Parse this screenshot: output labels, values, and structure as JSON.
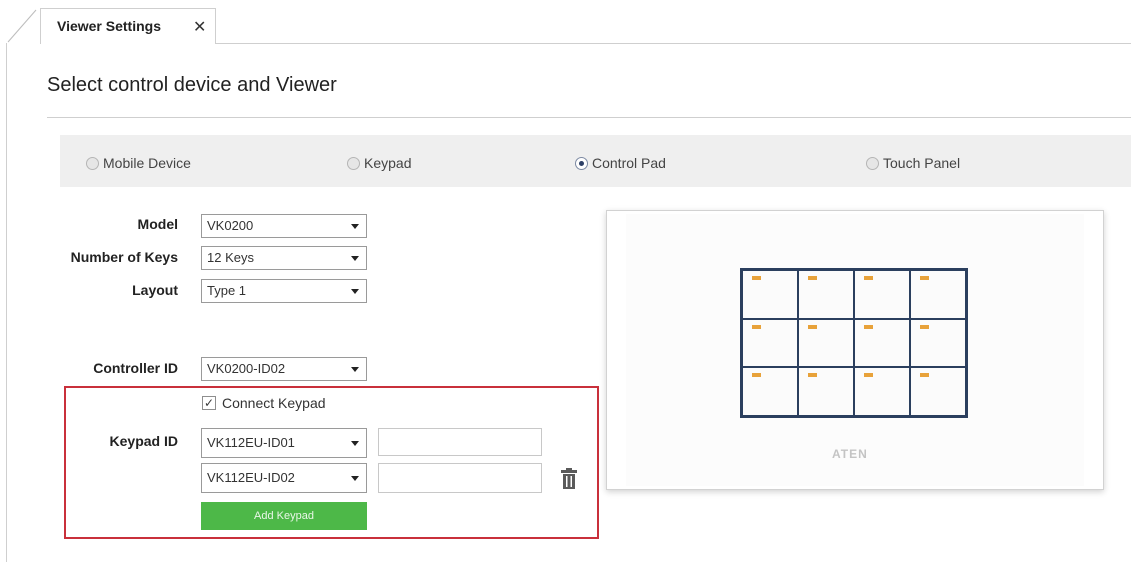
{
  "tab": {
    "label": "Viewer Settings",
    "close": "✕"
  },
  "title": "Select control device and Viewer",
  "device_types": [
    {
      "label": "Mobile Device",
      "selected": false
    },
    {
      "label": "Keypad",
      "selected": false
    },
    {
      "label": "Control Pad",
      "selected": true
    },
    {
      "label": "Touch Panel",
      "selected": false
    }
  ],
  "form": {
    "model_label": "Model",
    "model_value": "VK0200",
    "keys_label": "Number of Keys",
    "keys_value": "12 Keys",
    "layout_label": "Layout",
    "layout_value": "Type 1",
    "controller_label": "Controller ID",
    "controller_value": "VK0200-ID02"
  },
  "keypad": {
    "connect_label": "Connect Keypad",
    "connect_checked": true,
    "check_mark": "✓",
    "id_label": "Keypad ID",
    "ids": [
      "VK112EU-ID01",
      "VK112EU-ID02"
    ],
    "add_label": "Add Keypad",
    "delete_icon": "trash-icon"
  },
  "preview": {
    "brand": "ATEN",
    "key_count": 12,
    "led_color": "#e8a23a"
  },
  "colors": {
    "accent_green": "#4db848",
    "highlight_red": "#c9303b",
    "grid_navy": "#2b3f5e"
  }
}
